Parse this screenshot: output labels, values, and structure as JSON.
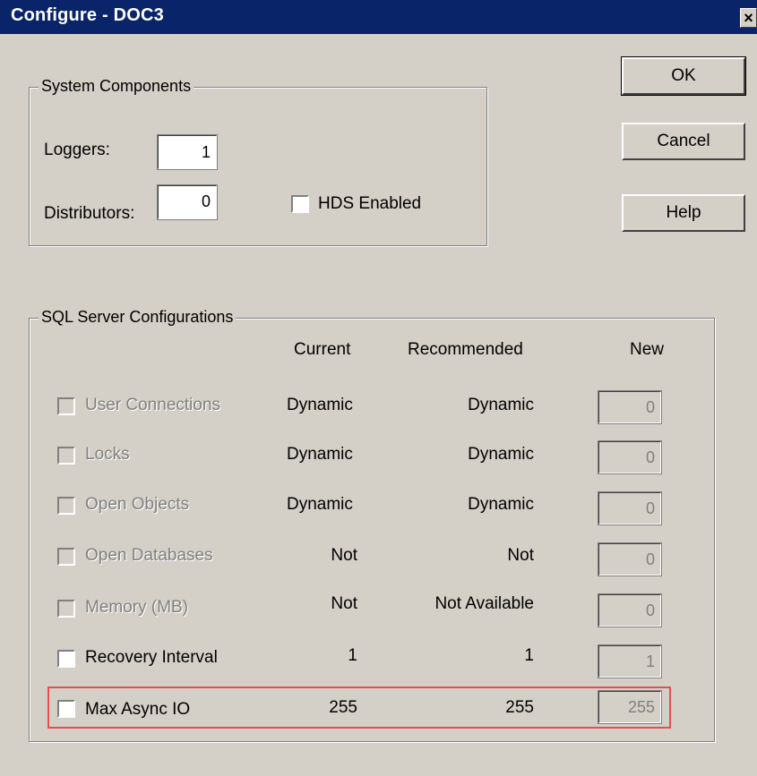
{
  "window": {
    "title": "Configure - DOC3",
    "close_glyph": "×"
  },
  "buttons": {
    "ok": "OK",
    "cancel": "Cancel",
    "help": "Help"
  },
  "system_components": {
    "legend": "System Components",
    "loggers_label": "Loggers:",
    "loggers_value": "1",
    "distributors_label": "Distributors:",
    "distributors_value": "0",
    "hds_label": "HDS Enabled"
  },
  "sql_server": {
    "legend": "SQL Server Configurations",
    "headers": {
      "current": "Current",
      "recommended": "Recommended",
      "new": "New"
    },
    "rows": [
      {
        "label": "User Connections",
        "current": "Dynamic",
        "recommended": "Dynamic",
        "new": "0",
        "enabled": false
      },
      {
        "label": "Locks",
        "current": "Dynamic",
        "recommended": "Dynamic",
        "new": "0",
        "enabled": false
      },
      {
        "label": "Open Objects",
        "current": "Dynamic",
        "recommended": "Dynamic",
        "new": "0",
        "enabled": false
      },
      {
        "label": "Open Databases",
        "current": "Not",
        "recommended": "Not",
        "new": "0",
        "enabled": false
      },
      {
        "label": "Memory (MB)",
        "current": "Not",
        "recommended": "Not Available",
        "new": "0",
        "enabled": false
      },
      {
        "label": "Recovery Interval",
        "current": "1",
        "recommended": "1",
        "new": "1",
        "enabled": true
      },
      {
        "label": "Max Async IO",
        "current": "255",
        "recommended": "255",
        "new": "255",
        "enabled": true
      }
    ]
  },
  "colors": {
    "titlebar": "#0a246a",
    "face": "#d4d0c8",
    "highlight": "#e05050",
    "disabled_text": "#808080"
  }
}
